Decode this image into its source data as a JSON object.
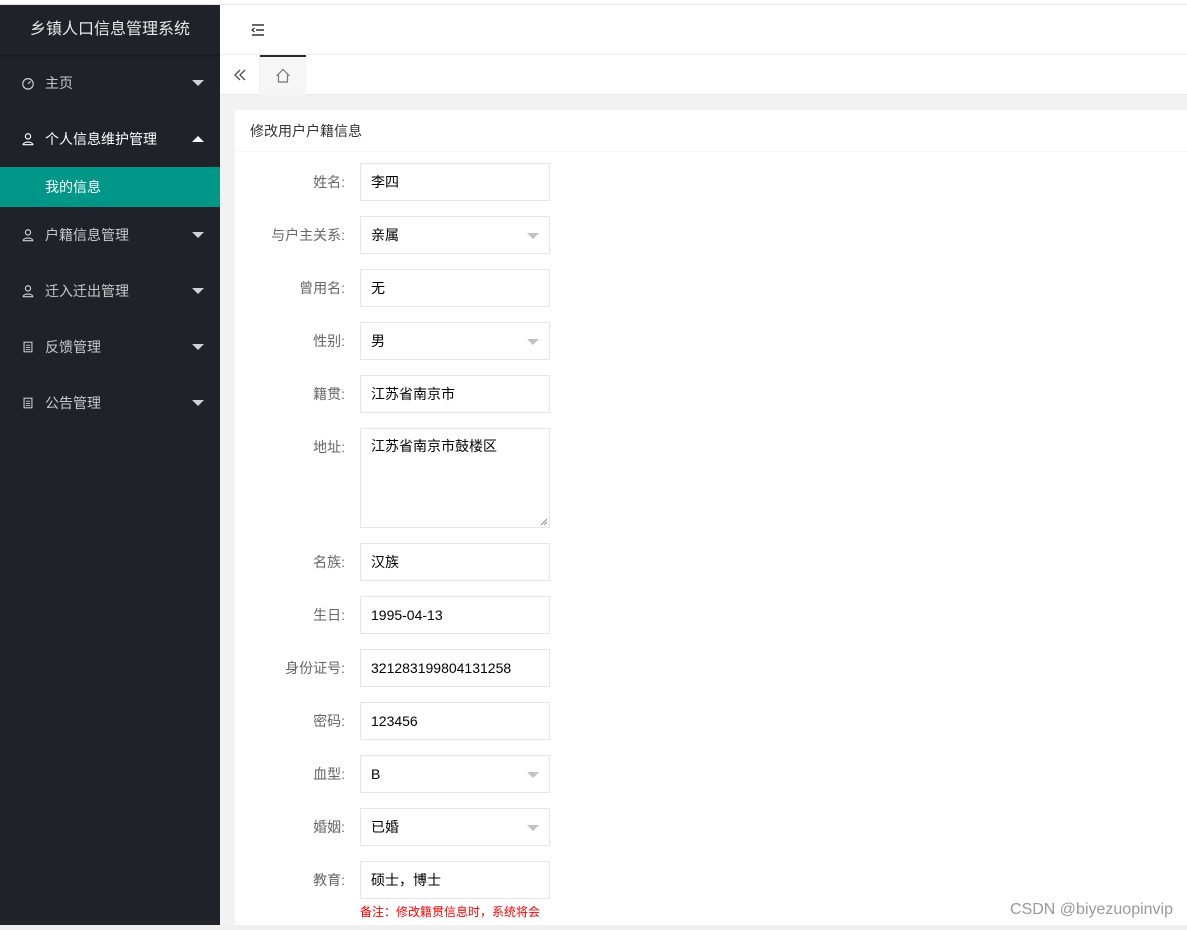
{
  "app": {
    "title": "乡镇人口信息管理系统"
  },
  "sidebar": {
    "items": [
      {
        "label": "主页",
        "icon": "dashboard-icon"
      },
      {
        "label": "个人信息维护管理",
        "icon": "user-icon",
        "sub": [
          "我的信息"
        ]
      },
      {
        "label": "户籍信息管理",
        "icon": "user-icon"
      },
      {
        "label": "迁入迁出管理",
        "icon": "user-icon"
      },
      {
        "label": "反馈管理",
        "icon": "document-icon"
      },
      {
        "label": "公告管理",
        "icon": "document-icon"
      }
    ]
  },
  "form": {
    "title": "修改用户户籍信息",
    "fields": [
      {
        "label": "姓名:",
        "value": "李四",
        "type": "input"
      },
      {
        "label": "与户主关系:",
        "value": "亲属",
        "type": "select"
      },
      {
        "label": "曾用名:",
        "value": "无",
        "type": "input"
      },
      {
        "label": "性别:",
        "value": "男",
        "type": "select"
      },
      {
        "label": "籍贯:",
        "value": "江苏省南京市",
        "type": "input"
      },
      {
        "label": "地址:",
        "value": "江苏省南京市鼓楼区",
        "type": "textarea"
      },
      {
        "label": "名族:",
        "value": "汉族",
        "type": "input"
      },
      {
        "label": "生日:",
        "value": "1995-04-13",
        "type": "input"
      },
      {
        "label": "身份证号:",
        "value": "321283199804131258",
        "type": "input"
      },
      {
        "label": "密码:",
        "value": "123456",
        "type": "input"
      },
      {
        "label": "血型:",
        "value": "B",
        "type": "select"
      },
      {
        "label": "婚姻:",
        "value": "已婚",
        "type": "select"
      },
      {
        "label": "教育:",
        "value": "硕士，博士",
        "type": "input"
      }
    ],
    "note": "备注：修改籍贯信息时，系统将会"
  },
  "watermark": "CSDN @biyezuopinvip",
  "colors": {
    "sidebar_bg": "#20222a",
    "active": "#009688",
    "note": "#ff0000"
  }
}
